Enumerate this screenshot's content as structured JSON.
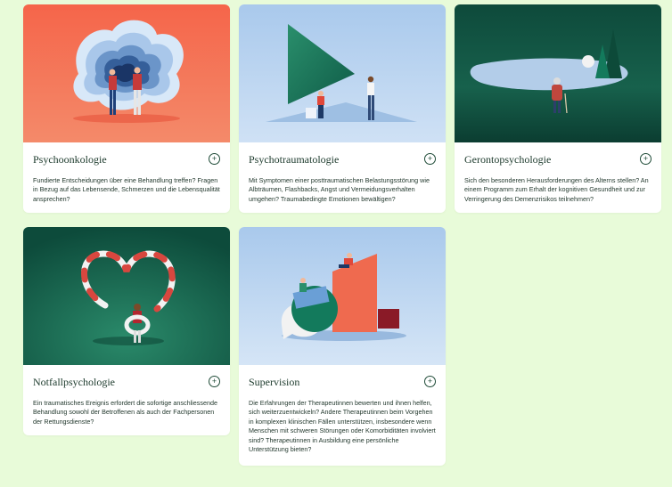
{
  "cards": [
    {
      "title": "Psychoonkologie",
      "description": "Fundierte Entscheidungen über eine Behandlung treffen? Fragen in Bezug auf das Lebensende, Schmerzen und die Lebensqualität ansprechen?",
      "expand_icon": "plus-circle-icon",
      "illustration_bg": "#f26b4e"
    },
    {
      "title": "Psychotraumatologie",
      "description": "Mit Symptomen einer posttraumatischen Belastungsstörung wie Albträumen, Flashbacks, Angst und Vermeidungsverhalten umgehen? Traumabedingte Emotionen bewältigen?",
      "expand_icon": "plus-circle-icon",
      "illustration_bg": "#b9d6f2"
    },
    {
      "title": "Gerontopsychologie",
      "description": "Sich den besonderen Herausforderungen des Alterns stellen? An einem Programm zum Erhalt der kognitiven Gesundheit und zur Verringerung des Demenzrisikos teilnehmen?",
      "expand_icon": "plus-circle-icon",
      "illustration_bg": "#0f5b47"
    },
    {
      "title": "Notfallpsychologie",
      "description": "Ein traumatisches Ereignis erfordert die sofortige anschliessende Behandlung sowohl der Betroffenen als auch der Fachpersonen der Rettungsdienste?",
      "expand_icon": "plus-circle-icon",
      "illustration_bg": "#0f5b47"
    },
    {
      "title": "Supervision",
      "description": "Die Erfahrungen der Therapeutinnen bewerten und ihnen helfen, sich weiterzuentwickeln? Andere Therapeutinnen beim Vorgehen in komplexen klinischen Fällen unterstützen, insbesondere wenn Menschen mit schweren Störungen oder Komorbiditäten involviert sind? Therapeutinnen in Ausbildung eine persönliche Unterstützung bieten?",
      "expand_icon": "plus-circle-icon",
      "illustration_bg": "#b9d6f2"
    }
  ],
  "plus_symbol": "+"
}
